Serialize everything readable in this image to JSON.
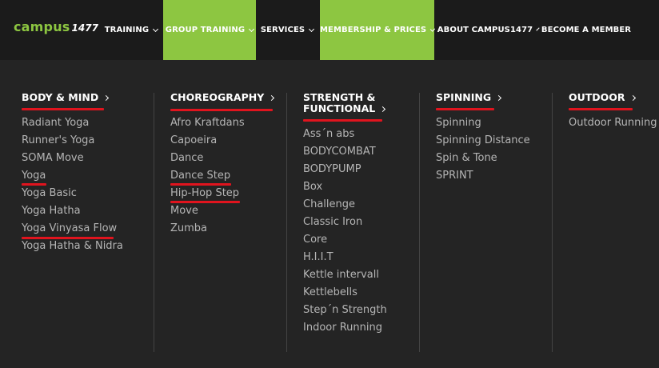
{
  "header": {
    "logo_word": "campus",
    "logo_number": "1477",
    "nav": [
      {
        "label": "TRAINING",
        "has_dropdown": true,
        "active": false
      },
      {
        "label": "GROUP TRAINING",
        "has_dropdown": true,
        "active": true
      },
      {
        "label": "SERVICES",
        "has_dropdown": true,
        "active": false
      },
      {
        "label": "MEMBERSHIP & PRICES",
        "has_dropdown": true,
        "active": true
      },
      {
        "label": "ABOUT CAMPUS1477",
        "has_dropdown": true,
        "active": false
      },
      {
        "label": "BECOME A MEMBER",
        "has_dropdown": false,
        "active": false
      }
    ]
  },
  "colors": {
    "accent_green": "#8dc641",
    "underline_red": "#e0141e",
    "background": "#242424",
    "topbar": "#1b1b1b",
    "item_text": "#b5b5b5"
  },
  "menu": {
    "columns": [
      {
        "heading": "BODY & MIND",
        "items": [
          "Radiant Yoga",
          "Runner's Yoga",
          "SOMA Move",
          "Yoga",
          "Yoga Basic",
          "Yoga Hatha",
          "Yoga Vinyasa Flow",
          "Yoga Hatha & Nidra"
        ]
      },
      {
        "heading": "CHOREOGRAPHY",
        "items": [
          "Afro Kraftdans",
          "Capoeira",
          "Dance",
          "Dance Step",
          "Hip-Hop Step",
          "Move",
          "Zumba"
        ]
      },
      {
        "heading_line1": "STRENGTH &",
        "heading_line2": "FUNCTIONAL",
        "items": [
          "Ass´n abs",
          "BODYCOMBAT",
          "BODYPUMP",
          "Box",
          "Challenge",
          "Classic Iron",
          "Core",
          "H.I.I.T",
          "Kettle intervall",
          "Kettlebells",
          "Step´n Strength",
          "Indoor Running"
        ]
      },
      {
        "heading": "SPINNING",
        "items": [
          "Spinning",
          "Spinning Distance",
          "Spin & Tone",
          "SPRINT"
        ]
      },
      {
        "heading": "OUTDOOR",
        "items": [
          "Outdoor Running"
        ]
      }
    ]
  }
}
